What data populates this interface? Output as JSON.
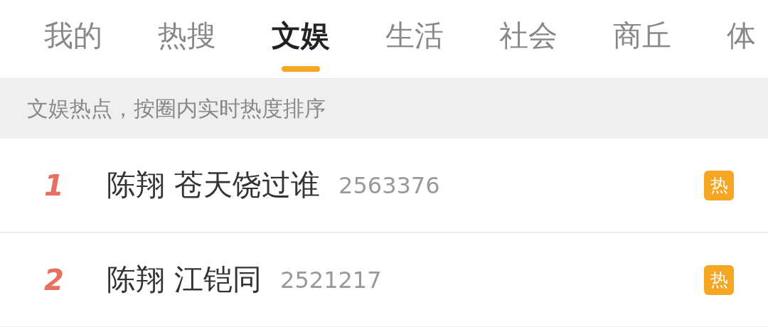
{
  "tabs": [
    {
      "label": "我的",
      "selected": false
    },
    {
      "label": "热搜",
      "selected": false
    },
    {
      "label": "文娱",
      "selected": true
    },
    {
      "label": "生活",
      "selected": false
    },
    {
      "label": "社会",
      "selected": false
    },
    {
      "label": "商丘",
      "selected": false
    },
    {
      "label": "体",
      "selected": false
    }
  ],
  "banner": {
    "text": "文娱热点，按圈内实时热度排序"
  },
  "items": [
    {
      "rank": "1",
      "title": "陈翔 苍天饶过谁",
      "count": "2563376",
      "badge": "热"
    },
    {
      "rank": "2",
      "title": "陈翔 江铠同",
      "count": "2521217",
      "badge": "热"
    }
  ]
}
